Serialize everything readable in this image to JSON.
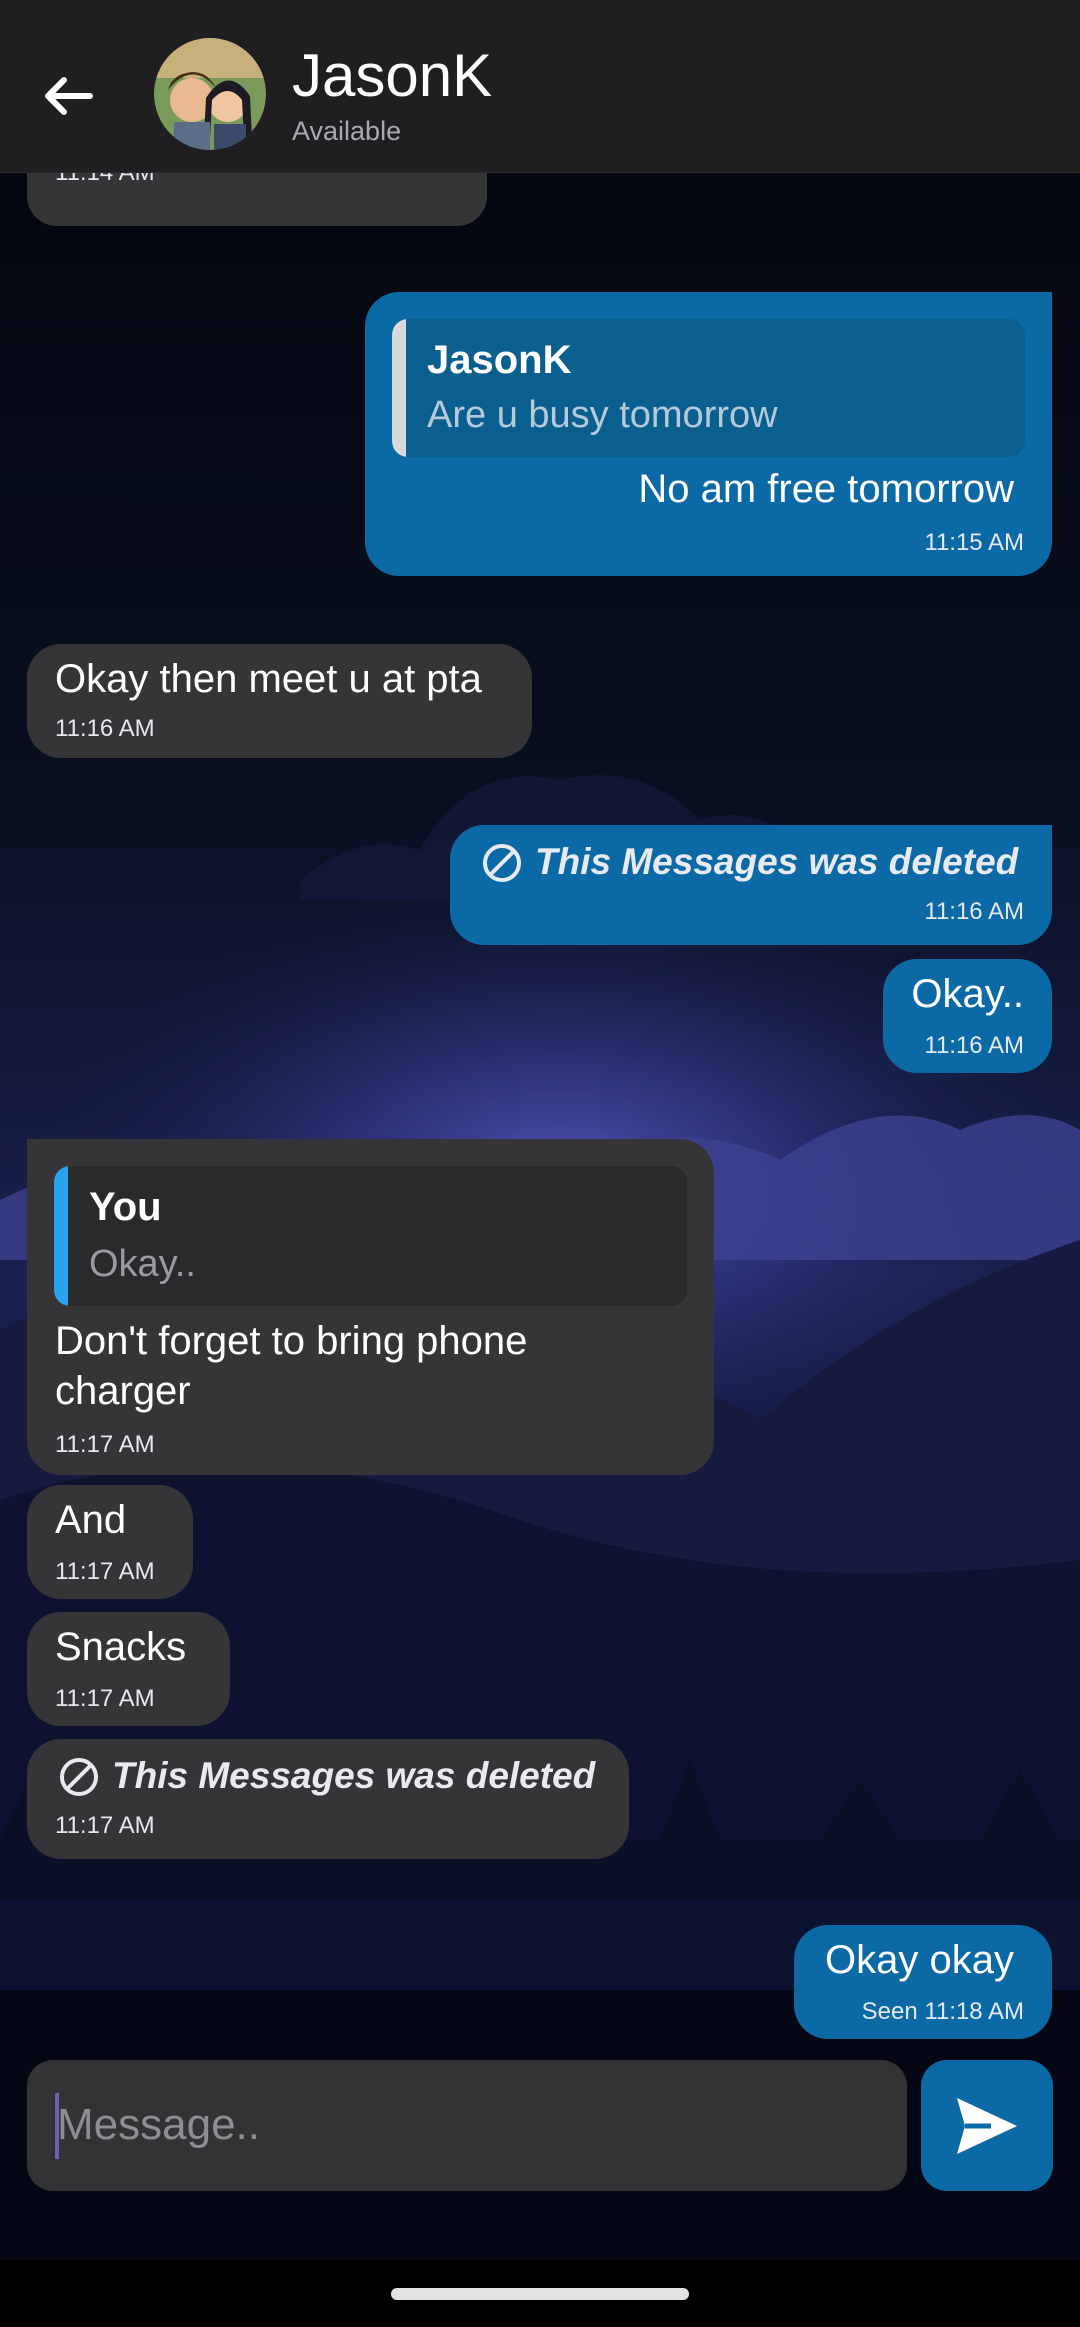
{
  "header": {
    "contact_name": "JasonK",
    "contact_status": "Available",
    "icons": {
      "back": "arrow-left-icon",
      "avatar": "contact-avatar"
    }
  },
  "messages": [
    {
      "dir": "in",
      "time": "11:14 AM"
    },
    {
      "dir": "out",
      "reply_to": {
        "name": "JasonK",
        "text": "Are u busy tomorrow"
      },
      "text": "No am free tomorrow",
      "time": "11:15 AM"
    },
    {
      "dir": "in",
      "text": "Okay then meet u at pta",
      "time": "11:16 AM"
    },
    {
      "dir": "out",
      "deleted": true,
      "text": "This Messages was deleted",
      "time": "11:16 AM"
    },
    {
      "dir": "out",
      "text": "Okay..",
      "time": "11:16 AM"
    },
    {
      "dir": "in",
      "reply_to": {
        "name": "You",
        "text": "Okay.."
      },
      "text_lines": [
        "Don't forget to bring phone",
        "charger"
      ],
      "time": "11:17 AM"
    },
    {
      "dir": "in",
      "text": "And",
      "time": "11:17 AM"
    },
    {
      "dir": "in",
      "text": "Snacks",
      "time": "11:17 AM"
    },
    {
      "dir": "in",
      "deleted": true,
      "text": "This Messages was deleted",
      "time": "11:17 AM"
    },
    {
      "dir": "out",
      "text": "Okay okay",
      "time": "Seen 11:18 AM"
    }
  ],
  "composer": {
    "placeholder": "Message..",
    "send_icon": "send-icon"
  },
  "colors": {
    "outgoing_bubble": "#0b6aa6",
    "incoming_bubble": "#353538",
    "header_bg": "#1f1f22",
    "reply_bar_out": "#d6d8dc",
    "reply_bar_in": "#2aa3f0"
  }
}
